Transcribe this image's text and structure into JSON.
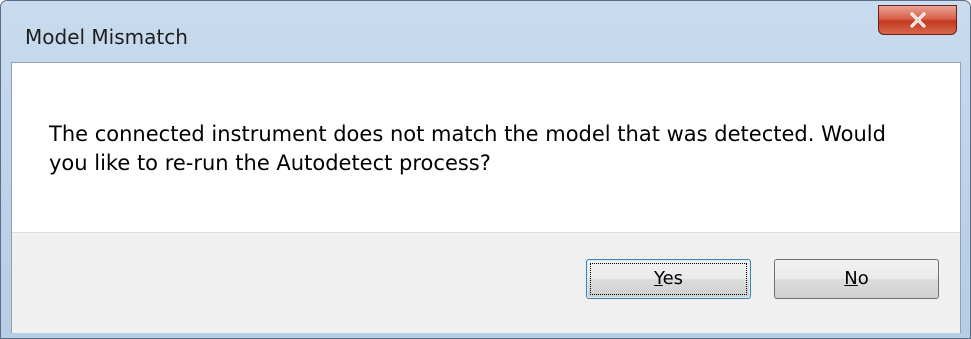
{
  "window": {
    "title": "Model Mismatch",
    "close_icon": "close-icon"
  },
  "message": {
    "line1": "The connected instrument does not match the model that was detected. Would",
    "line2": "you like to re-run the Autodetect process?"
  },
  "buttons": {
    "yes": {
      "mnemonic": "Y",
      "rest": "es"
    },
    "no": {
      "mnemonic": "N",
      "rest": "o"
    }
  },
  "colors": {
    "close_button": "#c3381f",
    "default_button_border": "#3c7fb1",
    "footer_background": "#f0f0f0"
  }
}
